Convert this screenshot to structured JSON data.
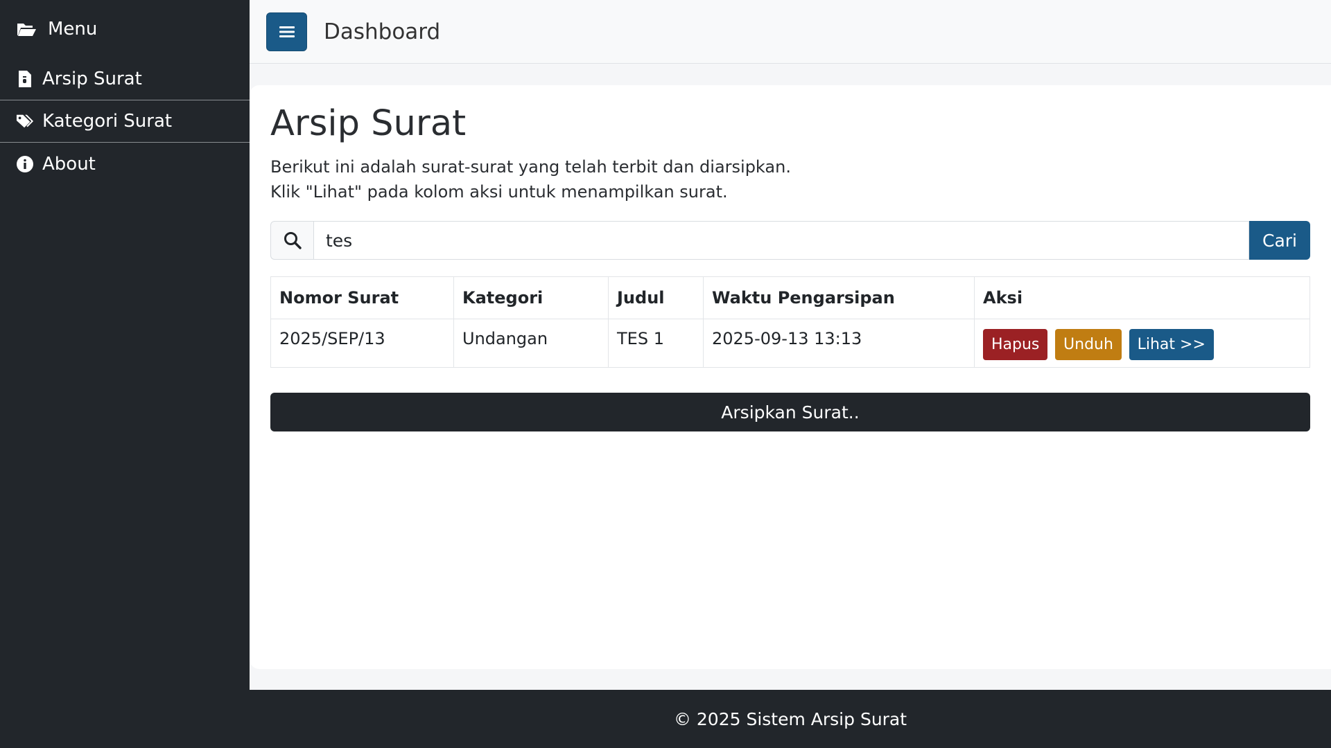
{
  "sidebar": {
    "menu_label": "Menu",
    "items": [
      {
        "label": "Arsip Surat",
        "icon": "file-icon"
      },
      {
        "label": "Kategori Surat",
        "icon": "tags-icon"
      },
      {
        "label": "About",
        "icon": "info-circle-icon"
      }
    ]
  },
  "topbar": {
    "title": "Dashboard",
    "toggle_icon": "hamburger-icon"
  },
  "main": {
    "title": "Arsip Surat",
    "description_line1": "Berikut ini adalah surat-surat yang telah terbit dan diarsipkan.",
    "description_line2": "Klik \"Lihat\" pada kolom aksi untuk menampilkan surat.",
    "search": {
      "value": "tes",
      "button_label": "Cari",
      "icon": "search-icon"
    },
    "table": {
      "headers": [
        "Nomor Surat",
        "Kategori",
        "Judul",
        "Waktu Pengarsipan",
        "Aksi"
      ],
      "rows": [
        {
          "nomor": "2025/SEP/13",
          "kategori": "Undangan",
          "judul": "TES 1",
          "waktu": "2025-09-13 13:13"
        }
      ],
      "actions": {
        "hapus": "Hapus",
        "unduh": "Unduh",
        "lihat": "Lihat >>"
      }
    },
    "archive_button": "Arsipkan Surat.."
  },
  "footer": {
    "text": "© 2025 Sistem Arsip Surat"
  },
  "colors": {
    "sidebar": "#22262b",
    "primary": "#1a5a88",
    "danger": "#9b2124",
    "warning": "#c07d12"
  }
}
